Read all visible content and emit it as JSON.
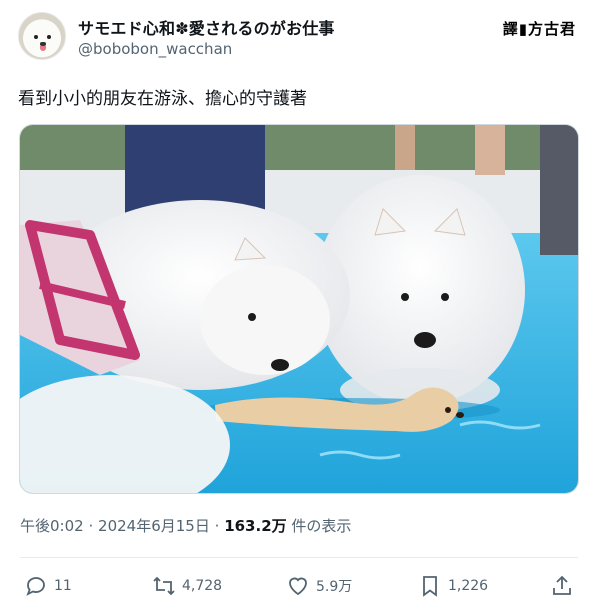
{
  "author": {
    "display_name": "サモエド心和✽愛されるのがお仕事",
    "handle": "@bobobon_wacchan",
    "avatar_icon": "samoyed-avatar"
  },
  "watermark": "譯▮方古君",
  "tweet": {
    "text": "看到小小的朋友在游泳、擔心的守護著"
  },
  "meta": {
    "time": "午後0:02",
    "date": "2024年6月15日",
    "views_count": "163.2万",
    "views_label": "件の表示",
    "separator": "·"
  },
  "actions": {
    "reply_count": "11",
    "retweet_count": "4,728",
    "like_count": "5.9万",
    "bookmark_count": "1,226"
  },
  "icons": {
    "reply": "reply-icon",
    "retweet": "retweet-icon",
    "like": "heart-icon",
    "bookmark": "bookmark-icon",
    "share": "share-icon"
  },
  "colors": {
    "text": "#0f1419",
    "secondary": "#536471",
    "pool_water": "#34b6e6",
    "harness": "#c2356e"
  }
}
